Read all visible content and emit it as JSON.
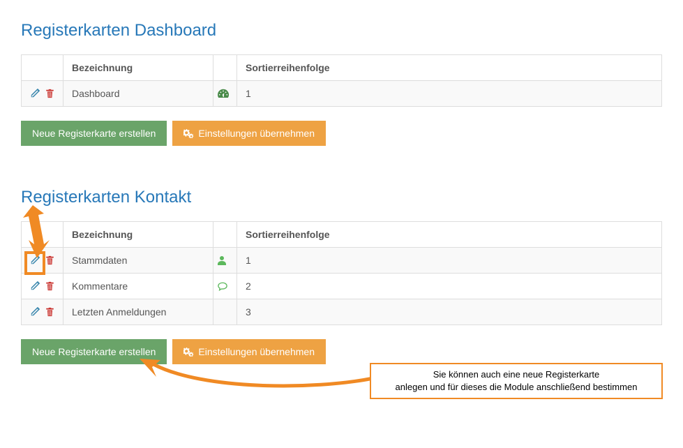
{
  "sections": {
    "dashboard": {
      "title": "Registerkarten Dashboard",
      "columns": {
        "label": "Bezeichnung",
        "sort": "Sortierreihenfolge"
      },
      "rows": [
        {
          "label": "Dashboard",
          "icon": "tachometer-icon",
          "sort": "1"
        }
      ],
      "create_label": "Neue Registerkarte erstellen",
      "apply_label": "Einstellungen übernehmen"
    },
    "kontakt": {
      "title": "Registerkarten Kontakt",
      "columns": {
        "label": "Bezeichnung",
        "sort": "Sortierreihenfolge"
      },
      "rows": [
        {
          "label": "Stammdaten",
          "icon": "user-icon",
          "sort": "1"
        },
        {
          "label": "Kommentare",
          "icon": "comment-icon",
          "sort": "2"
        },
        {
          "label": "Letzten Anmeldungen",
          "icon": "",
          "sort": "3"
        }
      ],
      "create_label": "Neue Registerkarte erstellen",
      "apply_label": "Einstellungen übernehmen"
    }
  },
  "annotation": {
    "callout_line1": "Sie können auch eine neue Registerkarte",
    "callout_line2": "anlegen und für dieses die Module anschließend bestimmen"
  },
  "colors": {
    "accent_blue": "#2778b8",
    "btn_green": "#6aa469",
    "btn_orange": "#eea243",
    "annotation_orange": "#f08a24",
    "icon_blue": "#3a87ad",
    "icon_red": "#c9302c",
    "icon_green": "#5cb85c",
    "icon_dark_green": "#4a8b4a"
  }
}
